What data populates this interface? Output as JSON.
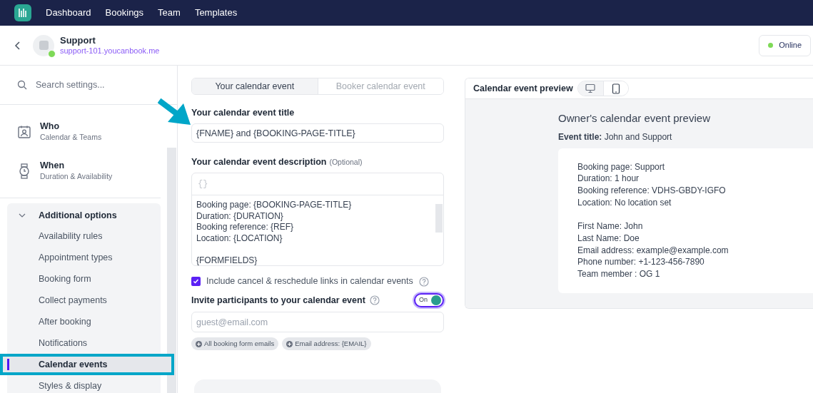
{
  "nav": {
    "items": [
      {
        "label": "Dashboard"
      },
      {
        "label": "Bookings"
      },
      {
        "label": "Team"
      },
      {
        "label": "Templates"
      }
    ]
  },
  "header": {
    "title": "Support",
    "url": "support-101.youcanbook.me",
    "status": "Online"
  },
  "sidebar": {
    "search_placeholder": "Search settings...",
    "sections": [
      {
        "kind": "who",
        "title": "Who",
        "subtitle": "Calendar & Teams"
      },
      {
        "kind": "when",
        "title": "When",
        "subtitle": "Duration & Availability"
      }
    ],
    "group": {
      "title": "Additional options",
      "expanded": true,
      "items": [
        {
          "label": "Availability rules",
          "selected": false
        },
        {
          "label": "Appointment types",
          "selected": false
        },
        {
          "label": "Booking form",
          "selected": false
        },
        {
          "label": "Collect payments",
          "selected": false
        },
        {
          "label": "After booking",
          "selected": false
        },
        {
          "label": "Notifications",
          "selected": false
        },
        {
          "label": "Calendar events",
          "selected": true
        },
        {
          "label": "Styles & display",
          "selected": false
        }
      ]
    }
  },
  "editor": {
    "tabs": [
      {
        "label": "Your calendar event",
        "selected": true
      },
      {
        "label": "Booker calendar event",
        "selected": false
      }
    ],
    "title_field": {
      "label": "Your calendar event title",
      "value": "{FNAME} and {BOOKING-PAGE-TITLE}"
    },
    "description": {
      "label": "Your calendar event description",
      "hint": "(Optional)",
      "toolbar": "{}",
      "value": "Booking page: {BOOKING-PAGE-TITLE}\nDuration: {DURATION}\nBooking reference: {REF}\nLocation: {LOCATION}\n\n{FORMFIELDS}"
    },
    "checkbox": {
      "label": "Include cancel & reschedule links in calendar events",
      "checked": true
    },
    "invite": {
      "label": "Invite participants to your calendar event",
      "on": true,
      "toggle_label": "On",
      "placeholder": "guest@email.com",
      "chips": [
        "All booking form emails",
        "Email address: {EMAIL}"
      ]
    }
  },
  "preview": {
    "title": "Calendar event preview",
    "views": [
      {
        "kind": "desktop",
        "selected": true
      },
      {
        "kind": "mobile",
        "selected": false
      }
    ],
    "heading": "Owner's calendar event preview",
    "event_title_label": "Event title:",
    "event_title": "John and Support",
    "blocks": [
      [
        "Booking page: Support",
        "Duration: 1 hour",
        "Booking reference: VDHS-GBDY-IGFO",
        "Location: No location set"
      ],
      [
        "First Name: John",
        "Last Name: Doe",
        "Email address: example@example.com",
        "Phone number: +1-123-456-7890",
        "Team member : OG 1"
      ]
    ]
  }
}
